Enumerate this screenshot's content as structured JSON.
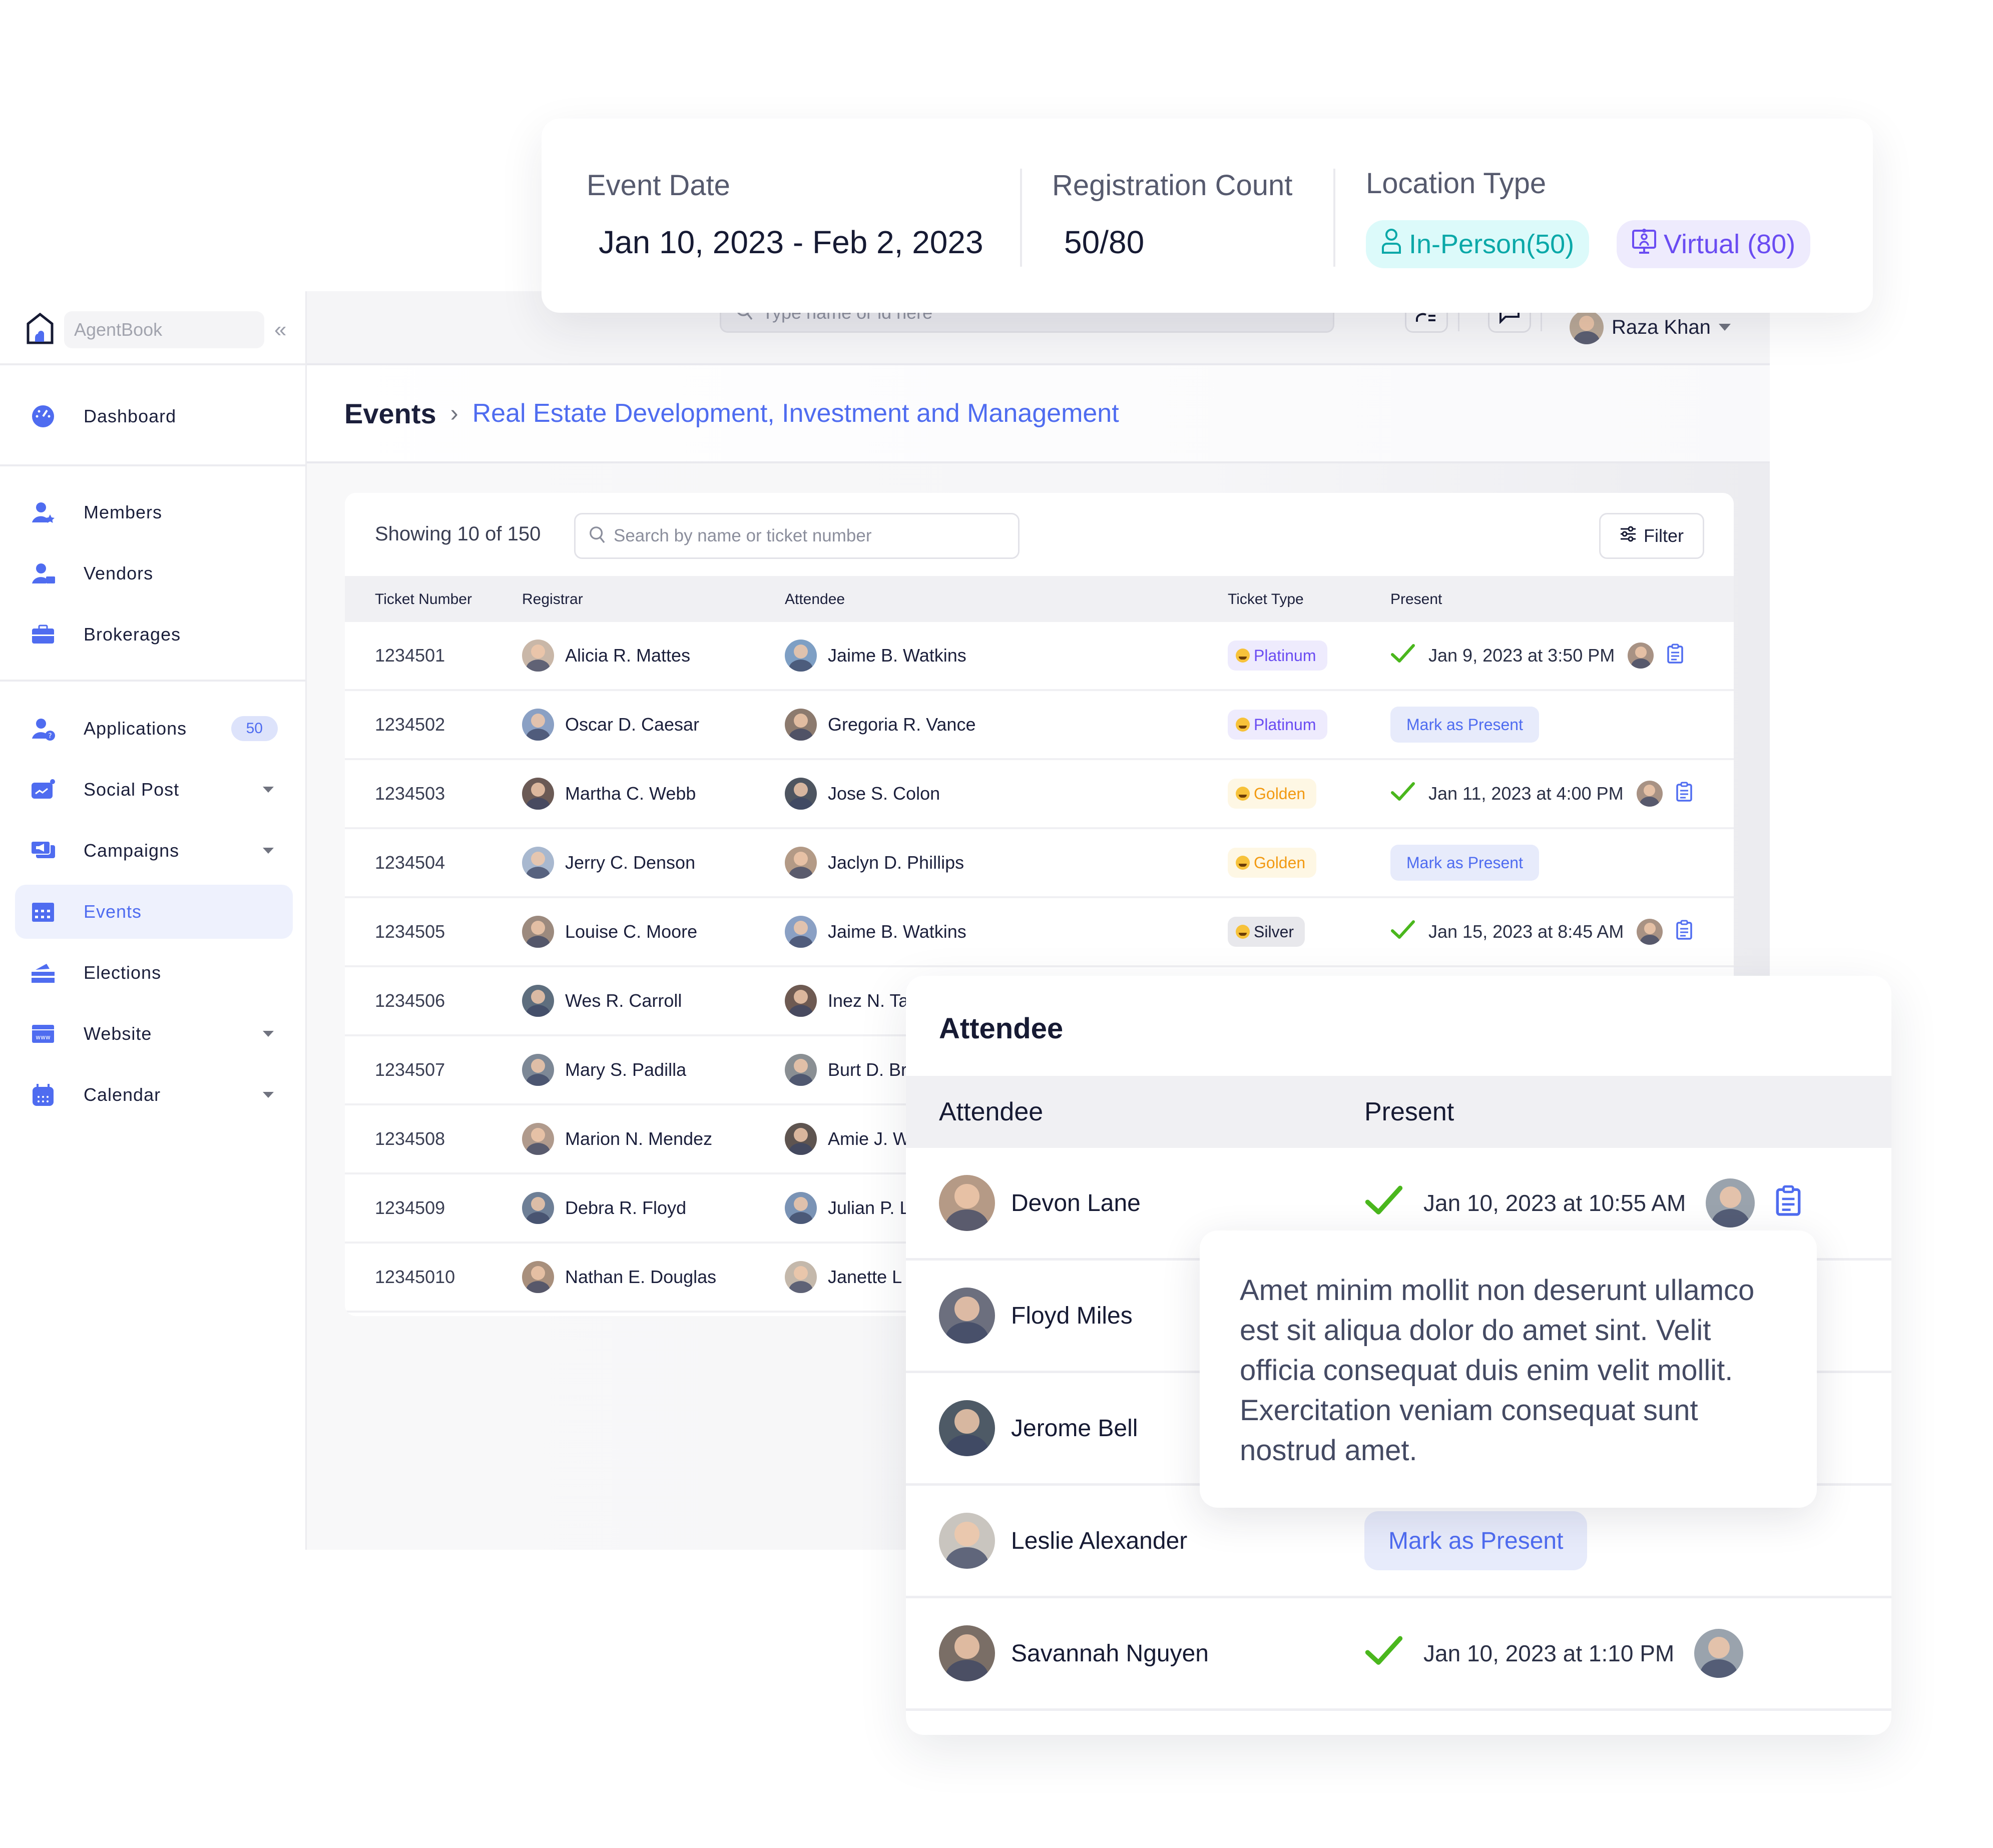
{
  "summary": {
    "event_date_label": "Event Date",
    "event_date_value": "Jan 10, 2023 - Feb 2, 2023",
    "registration_label": "Registration Count",
    "registration_value": "50/80",
    "location_label": "Location Type",
    "in_person_label": "In-Person(50)",
    "virtual_label": "Virtual (80)",
    "colors": {
      "in_person_bg": "#dcfafa",
      "in_person_fg": "#0aa8a8",
      "virtual_bg": "#eeebfd",
      "virtual_fg": "#6a4cf2"
    }
  },
  "brand": {
    "name": "AgentBook",
    "collapse_icon": "double-chevron-left-icon"
  },
  "header": {
    "search_placeholder": "Type name or id here",
    "user_name": "Raza Khan",
    "notification_dot_colors": [
      "#e4502e",
      "#4ab71d"
    ]
  },
  "sidebar": {
    "items": [
      {
        "label": "Dashboard",
        "icon": "dashboard-gauge-icon"
      },
      {
        "label": "Members",
        "icon": "member-star-icon"
      },
      {
        "label": "Vendors",
        "icon": "vendor-briefcase-icon"
      },
      {
        "label": "Brokerages",
        "icon": "briefcase-icon"
      },
      {
        "label": "Applications",
        "icon": "application-question-icon",
        "badge": "50"
      },
      {
        "label": "Social Post",
        "icon": "social-chart-icon",
        "has_submenu": true
      },
      {
        "label": "Campaigns",
        "icon": "megaphone-icon",
        "has_submenu": true
      },
      {
        "label": "Events",
        "icon": "calendar-grid-icon",
        "active": true
      },
      {
        "label": "Elections",
        "icon": "ballot-box-icon"
      },
      {
        "label": "Website",
        "icon": "browser-www-icon",
        "has_submenu": true
      },
      {
        "label": "Calendar",
        "icon": "calendar-icon",
        "has_submenu": true
      }
    ]
  },
  "breadcrumb": {
    "root": "Events",
    "separator": ">",
    "current": "Real Estate Development, Investment and Management"
  },
  "table": {
    "showing": "Showing 10 of 150",
    "search_placeholder": "Search by name or ticket number",
    "filter_label": "Filter",
    "columns": [
      "Ticket Number",
      "Registrar",
      "Attendee",
      "Ticket Type",
      "Present"
    ],
    "mark_label": "Mark as Present",
    "rows": [
      {
        "ticket": "1234501",
        "registrar": "Alicia R. Mattes",
        "attendee": "Jaime B. Watkins",
        "type": "Platinum",
        "present": "Jan 9, 2023 at 3:50 PM"
      },
      {
        "ticket": "1234502",
        "registrar": "Oscar D. Caesar",
        "attendee": "Gregoria R. Vance",
        "type": "Platinum",
        "present": null
      },
      {
        "ticket": "1234503",
        "registrar": "Martha C. Webb",
        "attendee": "Jose S. Colon",
        "type": "Golden",
        "present": "Jan 11, 2023 at 4:00 PM"
      },
      {
        "ticket": "1234504",
        "registrar": "Jerry C. Denson",
        "attendee": "Jaclyn D. Phillips",
        "type": "Golden",
        "present": null
      },
      {
        "ticket": "1234505",
        "registrar": "Louise C. Moore",
        "attendee": "Jaime B. Watkins",
        "type": "Silver",
        "present": "Jan 15, 2023 at 8:45 AM"
      },
      {
        "ticket": "1234506",
        "registrar": "Wes R. Carroll",
        "attendee": "Inez N. Ta"
      },
      {
        "ticket": "1234507",
        "registrar": "Mary S. Padilla",
        "attendee": "Burt D. Br"
      },
      {
        "ticket": "1234508",
        "registrar": "Marion N. Mendez",
        "attendee": "Amie J. W"
      },
      {
        "ticket": "1234509",
        "registrar": "Debra R. Floyd",
        "attendee": "Julian P. L"
      },
      {
        "ticket": "12345010",
        "registrar": "Nathan E. Douglas",
        "attendee": "Janette L"
      }
    ],
    "ticket_colors": {
      "Platinum": {
        "bg": "#eeebfd",
        "fg": "#6a4cf2"
      },
      "Golden": {
        "bg": "#fef7e4",
        "fg": "#f29a12"
      },
      "Silver": {
        "bg": "#e8e8ec",
        "fg": "#1b1f3b"
      }
    }
  },
  "attendee_popup": {
    "title": "Attendee",
    "columns": [
      "Attendee",
      "Present"
    ],
    "mark_label": "Mark as Present",
    "rows": [
      {
        "name": "Devon Lane",
        "present": "Jan 10, 2023 at 10:55 AM",
        "has_note": true
      },
      {
        "name": "Floyd Miles",
        "present": null
      },
      {
        "name": "Jerome Bell",
        "present": null
      },
      {
        "name": "Leslie Alexander",
        "present": null,
        "show_mark": true
      },
      {
        "name": "Savannah Nguyen",
        "present": "Jan 10, 2023 at 1:10 PM"
      }
    ]
  },
  "tooltip": {
    "text": "Amet minim mollit non deserunt ullamco est sit aliqua dolor do amet sint. Velit officia consequat duis enim velit mollit. Exercitation veniam consequat sunt nostrud amet."
  },
  "colors": {
    "accent": "#4f6cf0",
    "success": "#4ab71d",
    "text": "#1b1f3b"
  }
}
